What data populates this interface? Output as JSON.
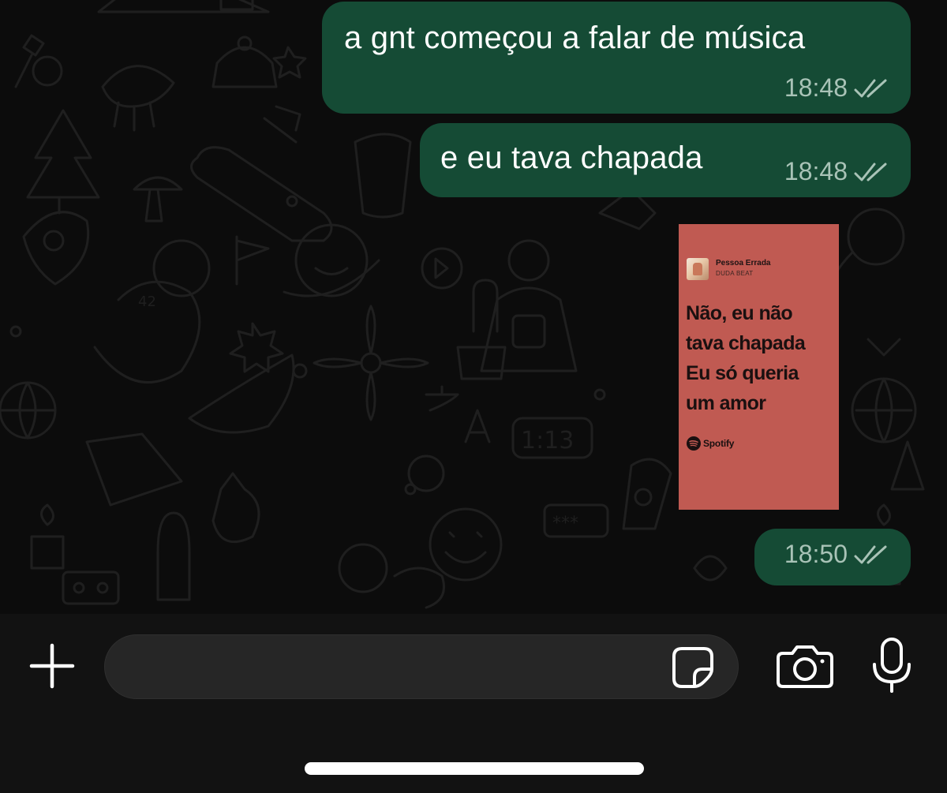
{
  "messages": [
    {
      "text": "a gnt começou a falar de música",
      "time": "18:48",
      "status": "read"
    },
    {
      "text": "e eu tava chapada",
      "time": "18:48",
      "status": "read"
    },
    {
      "time": "18:50",
      "status": "read"
    }
  ],
  "lyric_card": {
    "song": "Pessoa Errada",
    "artist": "DUDA BEAT",
    "lyrics": [
      "Não, eu não",
      "tava chapada",
      "Eu só queria",
      "um amor"
    ],
    "brand": "Spotify",
    "background_color": "#c05a52"
  },
  "composer": {
    "message_value": "",
    "icons": [
      "plus-icon",
      "sticker-icon",
      "camera-icon",
      "microphone-icon"
    ]
  },
  "theme": {
    "bubble_color": "#154b35",
    "read_tick_color": "#a9c3b7"
  }
}
